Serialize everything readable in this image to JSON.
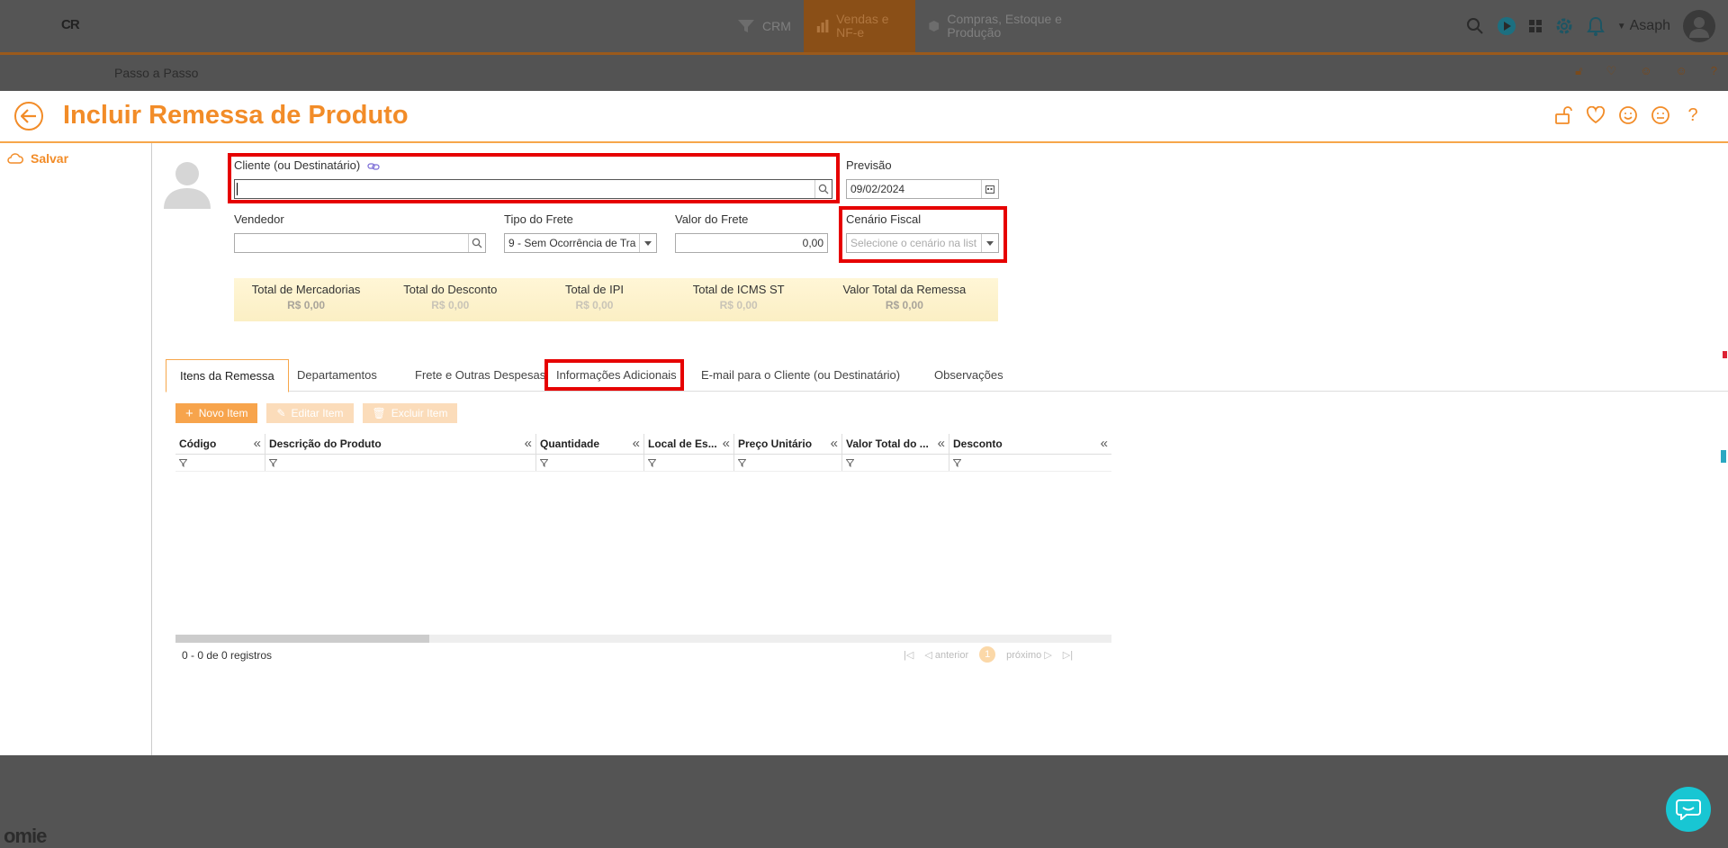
{
  "topbar": {
    "logo": "CR",
    "nav": [
      {
        "label": "CRM",
        "icon": "funnel-icon"
      },
      {
        "label": "Vendas e NF-e",
        "icon": "chart-icon"
      },
      {
        "label": "Compras, Estoque e Produção",
        "icon": "box-icon"
      }
    ],
    "user_name": "Asaph"
  },
  "subbar": {
    "crumb": "Passo a Passo"
  },
  "page": {
    "title": "Incluir Remessa de Produto"
  },
  "sidebar": {
    "save_label": "Salvar"
  },
  "form": {
    "cliente_label": "Cliente (ou Destinatário)",
    "cliente_value": "",
    "previsao_label": "Previsão",
    "previsao_value": "09/02/2024",
    "vendedor_label": "Vendedor",
    "vendedor_value": "",
    "tipo_frete_label": "Tipo do Frete",
    "tipo_frete_value": "9 - Sem Ocorrência de Tra",
    "valor_frete_label": "Valor do Frete",
    "valor_frete_value": "0,00",
    "cenario_label": "Cenário Fiscal",
    "cenario_placeholder": "Selecione o cenário na list"
  },
  "totals": [
    {
      "label": "Total de Mercadorias",
      "value": "R$ 0,00"
    },
    {
      "label": "Total do Desconto",
      "value": "R$ 0,00"
    },
    {
      "label": "Total de IPI",
      "value": "R$ 0,00"
    },
    {
      "label": "Total de ICMS ST",
      "value": "R$ 0,00"
    },
    {
      "label": "Valor Total da Remessa",
      "value": "R$ 0,00"
    }
  ],
  "tabs": [
    "Itens da Remessa",
    "Departamentos",
    "Frete e Outras Despesas",
    "Informações Adicionais",
    "E-mail para o Cliente (ou Destinatário)",
    "Observações"
  ],
  "grid_toolbar": {
    "new_label": "Novo Item",
    "edit_label": "Editar Item",
    "delete_label": "Excluir Item"
  },
  "grid": {
    "columns": [
      "Código",
      "Descrição do Produto",
      "Quantidade",
      "Local de Es...",
      "Preço Unitário",
      "Valor Total do ...",
      "Desconto"
    ],
    "records_text": "0 - 0 de 0 registros",
    "pager": {
      "prev": "anterior",
      "page": "1",
      "next": "próximo"
    }
  },
  "footer": {
    "logo": "omie"
  },
  "colors": {
    "accent": "#f28c28",
    "highlight": "#e60000",
    "chat": "#18c6d3"
  }
}
